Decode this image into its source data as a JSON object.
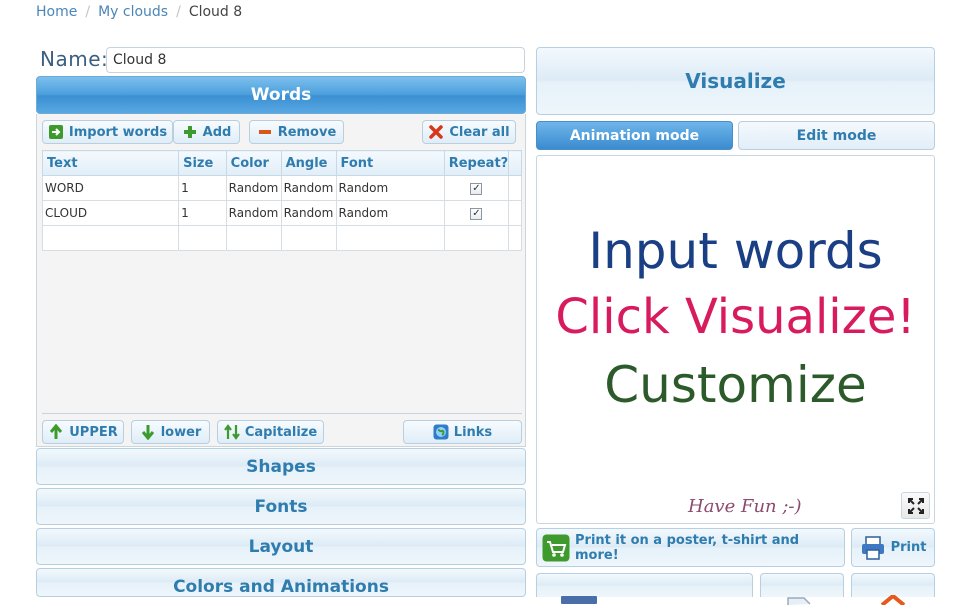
{
  "breadcrumb": {
    "home": "Home",
    "my_clouds": "My clouds",
    "current": "Cloud 8",
    "separator": "/"
  },
  "name": {
    "label": "Name:",
    "value": "Cloud 8"
  },
  "panels": {
    "words": "Words",
    "shapes": "Shapes",
    "fonts": "Fonts",
    "layout": "Layout",
    "colors": "Colors and Animations"
  },
  "toolbar": {
    "import": "Import words",
    "add": "Add",
    "remove": "Remove",
    "clear": "Clear all"
  },
  "table": {
    "headers": [
      "Text",
      "Size",
      "Color",
      "Angle",
      "Font",
      "Repeat?"
    ],
    "rows": [
      {
        "text": "WORD",
        "size": "1",
        "color": "Random",
        "angle": "Random",
        "font": "Random",
        "repeat": "✓"
      },
      {
        "text": "CLOUD",
        "size": "1",
        "color": "Random",
        "angle": "Random",
        "font": "Random",
        "repeat": "✓"
      }
    ]
  },
  "case_buttons": {
    "upper": "UPPER",
    "lower": "lower",
    "capitalize": "Capitalize",
    "links": "Links"
  },
  "right": {
    "visualize": "Visualize",
    "animation_mode": "Animation mode",
    "edit_mode": "Edit mode",
    "canvas_lines": [
      "Input words",
      "Click Visualize!",
      "Customize"
    ],
    "have_fun": "Have Fun ;-)",
    "print_poster": "Print it on a poster, t-shirt and more!",
    "print": "Print"
  },
  "colors": {
    "line1": "#1b3f85",
    "line2": "#d81b5e",
    "line3": "#2d5a2a",
    "accent": "#2f7cae"
  },
  "icons": {
    "import": "import-arrow-icon",
    "add": "plus-icon",
    "remove": "minus-icon",
    "clear": "x-icon",
    "upper": "arrow-up-icon",
    "lower": "arrow-down-icon",
    "capitalize": "arrows-updown-icon",
    "links": "globe-icon",
    "expand": "fullscreen-icon",
    "cart": "cart-icon",
    "print": "printer-icon"
  }
}
